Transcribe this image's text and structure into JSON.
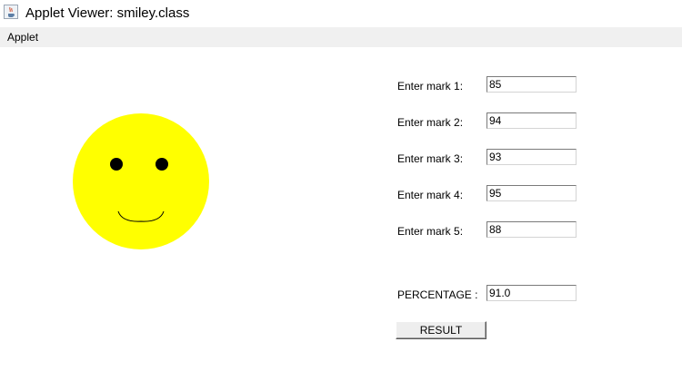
{
  "window": {
    "title": "Applet Viewer: smiley.class"
  },
  "menubar": {
    "items": [
      {
        "label": "Applet"
      }
    ]
  },
  "applet": {
    "smiley": {
      "face_color": "#ffff00",
      "eye_color": "#000000"
    },
    "fields": [
      {
        "label": "Enter mark 1:",
        "value": "85"
      },
      {
        "label": "Enter mark 2:",
        "value": "94"
      },
      {
        "label": "Enter mark 3:",
        "value": "93"
      },
      {
        "label": "Enter mark 4:",
        "value": "95"
      },
      {
        "label": "Enter mark 5:",
        "value": "88"
      }
    ],
    "percentage": {
      "label": "PERCENTAGE :",
      "value": "91.0"
    },
    "result_button": {
      "label": "RESULT"
    }
  }
}
